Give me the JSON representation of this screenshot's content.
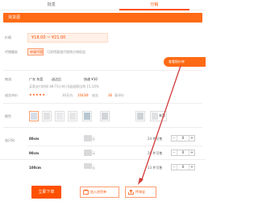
{
  "tabs": [
    {
      "label": "批发"
    },
    {
      "label": "分销"
    }
  ],
  "banner": {
    "title": "淘货源"
  },
  "price": {
    "label": "价格",
    "range": "¥18.00 ~ ¥21.00"
  },
  "agent": {
    "label": "代销服务",
    "tag": "申请代理",
    "desc": "可获得渠道代理商分销权益"
  },
  "float_button": {
    "label": "查看报价单"
  },
  "logistics": {
    "label": "物流",
    "origin": "广东 东莞",
    "method": "送达后",
    "speed": "快递 ¥10",
    "line2": "买家支付时间 48-72小时  闪退退款比例 15.10%"
  },
  "transaction": {
    "label": "成交评价",
    "stars": "★★★★★",
    "orders_prefix": "30天内",
    "orders_value": "1043件",
    "orders_suffix": "成交",
    "reviews_value": "36",
    "reviews_suffix": "条评价"
  },
  "color": {
    "label": "颜色",
    "extra": "玄黑"
  },
  "size": {
    "label": "选尺码"
  },
  "rows": [
    {
      "size": "80cm",
      "price": "元",
      "stock": "24 件可售",
      "qty": "0"
    },
    {
      "size": "90cm",
      "price": "元",
      "stock": "28 件可售",
      "qty": "0"
    },
    {
      "size": "100cm",
      "price": "元",
      "stock": "13 件可售",
      "qty": "0"
    }
  ],
  "buttons": {
    "order": "立即下单",
    "add_cart": "加入进货单",
    "distribute": "传淘宝"
  },
  "colors": {
    "accent": "#ff5000",
    "banner": "#ff6a14",
    "arrow": "#d23b3b"
  },
  "icons": [
    "cart-icon",
    "upload-icon",
    "minus-icon",
    "plus-icon"
  ]
}
